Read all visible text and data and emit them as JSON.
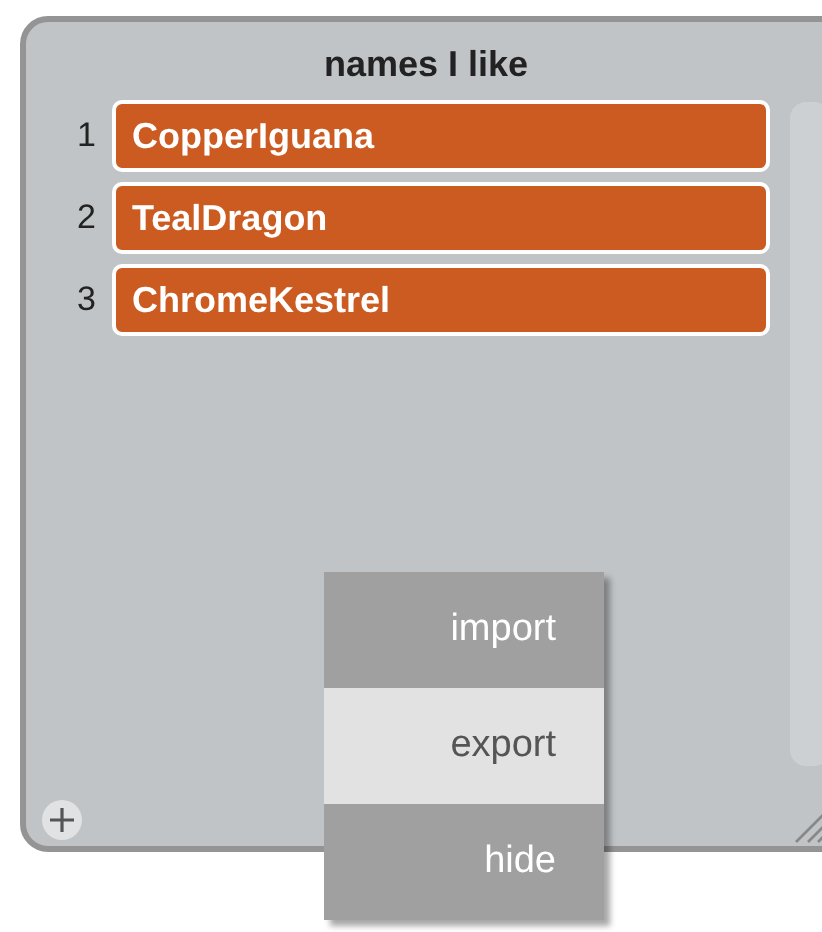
{
  "list_monitor": {
    "title": "names I like",
    "items": [
      {
        "index": "1",
        "value": "CopperIguana"
      },
      {
        "index": "2",
        "value": "TealDragon"
      },
      {
        "index": "3",
        "value": "ChromeKestrel"
      }
    ]
  },
  "context_menu": {
    "items": [
      {
        "label": "import",
        "selected": false
      },
      {
        "label": "export",
        "selected": true
      },
      {
        "label": "hide",
        "selected": false
      }
    ]
  }
}
